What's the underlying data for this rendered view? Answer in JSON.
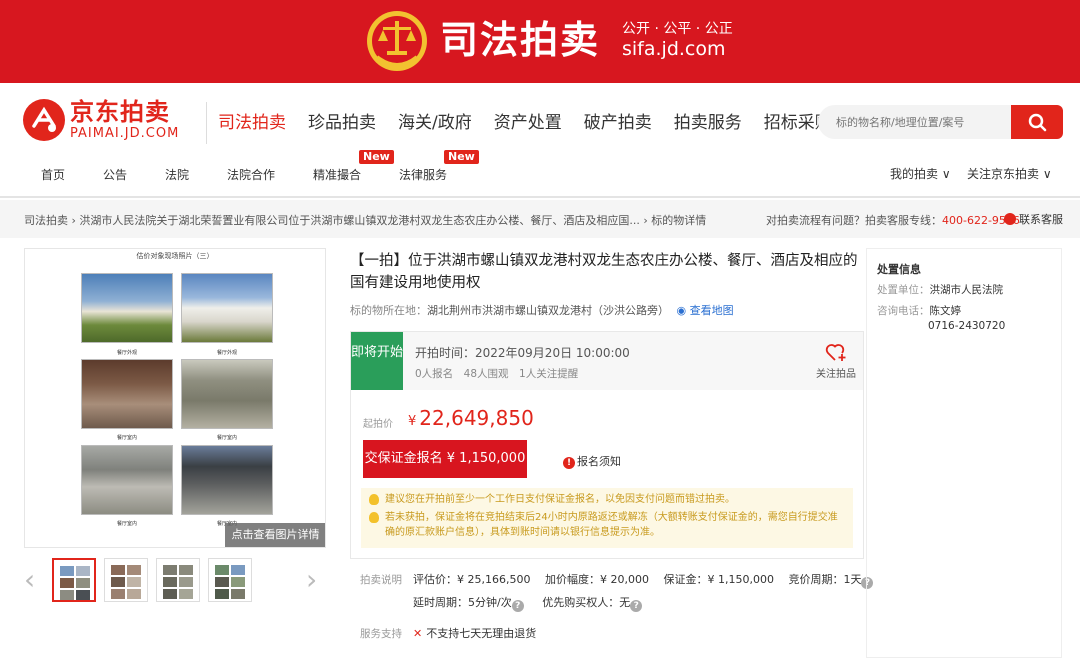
{
  "banner": {
    "title": "司法拍卖",
    "slogan": "公开 · 公平 · 公正",
    "url": "sifa.jd.com"
  },
  "logo": {
    "cn": "京东拍卖",
    "en": "PAIMAI.JD.COM"
  },
  "main_nav": [
    "司法拍卖",
    "珍品拍卖",
    "海关/政府",
    "资产处置",
    "破产拍卖",
    "拍卖服务",
    "招标采购"
  ],
  "search": {
    "placeholder": "标的物名称/地理位置/案号"
  },
  "sub_nav": {
    "items": [
      "首页",
      "公告",
      "法院",
      "法院合作",
      "精准撮合",
      "法律服务"
    ],
    "new_tag": "New",
    "right": [
      "我的拍卖 ∨",
      "关注京东拍卖 ∨"
    ]
  },
  "breadcrumb": {
    "path": "司法拍卖 › 洪湖市人民法院关于湖北荣誓置业有限公司位于洪湖市螺山镇双龙港村双龙生态农庄办公楼、餐厅、酒店及相应国... › 标的物详情",
    "question": "对拍卖流程有问题？拍卖客服专线：",
    "hotline": "400-622-9586",
    "contact": "联系客服"
  },
  "gallery": {
    "caption": "估价对象现场照片（三）",
    "labels": [
      "餐厅外观",
      "餐厅外观",
      "餐厅室内",
      "餐厅室内",
      "餐厅室内",
      "餐厅室内"
    ],
    "view_btn": "点击查看图片详情"
  },
  "item": {
    "title": "【一拍】位于洪湖市螺山镇双龙港村双龙生态农庄办公楼、餐厅、酒店及相应的国有建设用地使用权",
    "loc_label": "标的物所在地：",
    "loc_value": "湖北荆州市洪湖市螺山镇双龙港村（沙洪公路旁）",
    "map_link": "查看地图"
  },
  "auction": {
    "status": "即将开始",
    "start_time": "开拍时间：2022年09月20日 10:00:00",
    "stats": "0人报名　48人围观　1人关注提醒",
    "follow": "关注拍品",
    "price_label": "起拍价",
    "currency": "¥",
    "price": "22,649,850",
    "deposit_btn": "交保证金报名 ¥ 1,150,000",
    "notice": "报名须知",
    "tips": [
      "建议您在开拍前至少一个工作日支付保证金报名，以免因支付问题而错过拍卖。",
      "若未获拍，保证金将在竞拍结束后24小时内原路返还或解冻（大额转账支付保证金的，需您自行提交准确的原汇款账户信息），具体到账时间请以银行信息提示为准。"
    ]
  },
  "details": {
    "label": "拍卖说明",
    "line1": {
      "eval": "评估价：¥ 25,166,500",
      "inc": "加价幅度：¥ 20,000",
      "dep": "保证金：¥ 1,150,000",
      "cycle": "竞价周期：1天"
    },
    "line2": {
      "delay": "延时周期：5分钟/次",
      "priority": "优先购买权人：无"
    },
    "service_label": "服务支持",
    "service": "不支持七天无理由退货"
  },
  "disposal": {
    "title": "处置信息",
    "unit_label": "处置单位：",
    "unit": "洪湖市人民法院",
    "phone_label": "咨询电话：",
    "contact_name": "陈文婷",
    "phone": "0716-2430720"
  },
  "colors": {
    "brand_red": "#d7171f",
    "status_green": "#2a9e5a",
    "tip_yellow": "#fdf8e4",
    "link_blue": "#2a6fd1"
  }
}
